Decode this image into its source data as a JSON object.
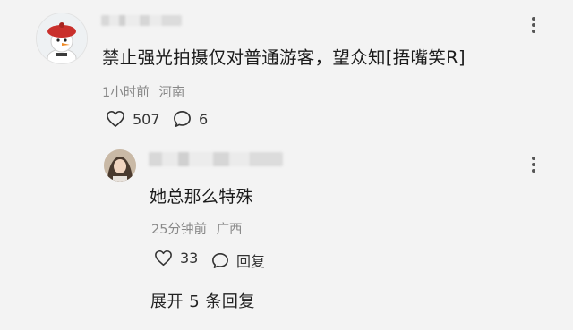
{
  "comment": {
    "text": "禁止强光拍摄仅对普通游客，望众知[捂嘴笑R]",
    "time": "1小时前",
    "location": "河南",
    "likes": "507",
    "replies": "6"
  },
  "reply": {
    "text": "她总那么特殊",
    "time": "25分钟前",
    "location": "广西",
    "likes": "33",
    "reply_label": "回复"
  },
  "expand_label": "展开 5 条回复",
  "icons": {
    "like": "heart-outline-icon",
    "comment": "speech-bubble-icon",
    "more": "vertical-ellipsis-icon"
  }
}
